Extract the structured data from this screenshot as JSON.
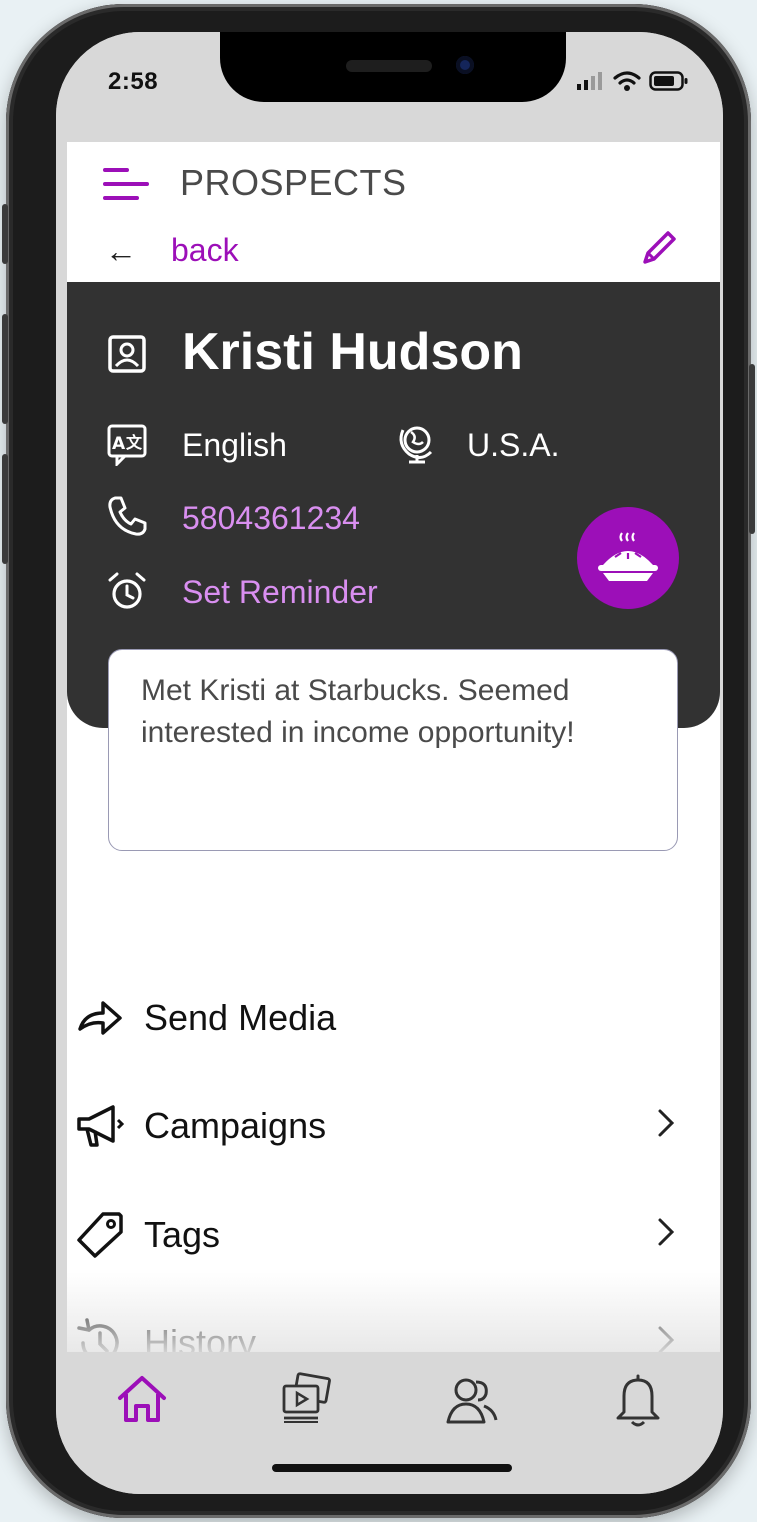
{
  "status": {
    "time": "2:58"
  },
  "header": {
    "title": "PROSPECTS",
    "back_label": "back"
  },
  "contact": {
    "name": "Kristi Hudson",
    "language": "English",
    "country": "U.S.A.",
    "phone": "5804361234",
    "reminder_label": "Set Reminder",
    "note": "Met Kristi at Starbucks. Seemed interested in income opportunity!"
  },
  "actions": [
    {
      "label": "Send Media",
      "icon": "send-icon"
    },
    {
      "label": "Campaigns",
      "icon": "megaphone-icon"
    },
    {
      "label": "Tags",
      "icon": "tag-icon"
    },
    {
      "label": "History",
      "icon": "history-icon"
    }
  ],
  "tabs": [
    {
      "icon": "home-icon",
      "active": true
    },
    {
      "icon": "media-icon",
      "active": false
    },
    {
      "icon": "contacts-icon",
      "active": false
    },
    {
      "icon": "bell-icon",
      "active": false
    }
  ],
  "colors": {
    "accent": "#9c0fb8",
    "card": "#323232",
    "link": "#d98ff0"
  }
}
